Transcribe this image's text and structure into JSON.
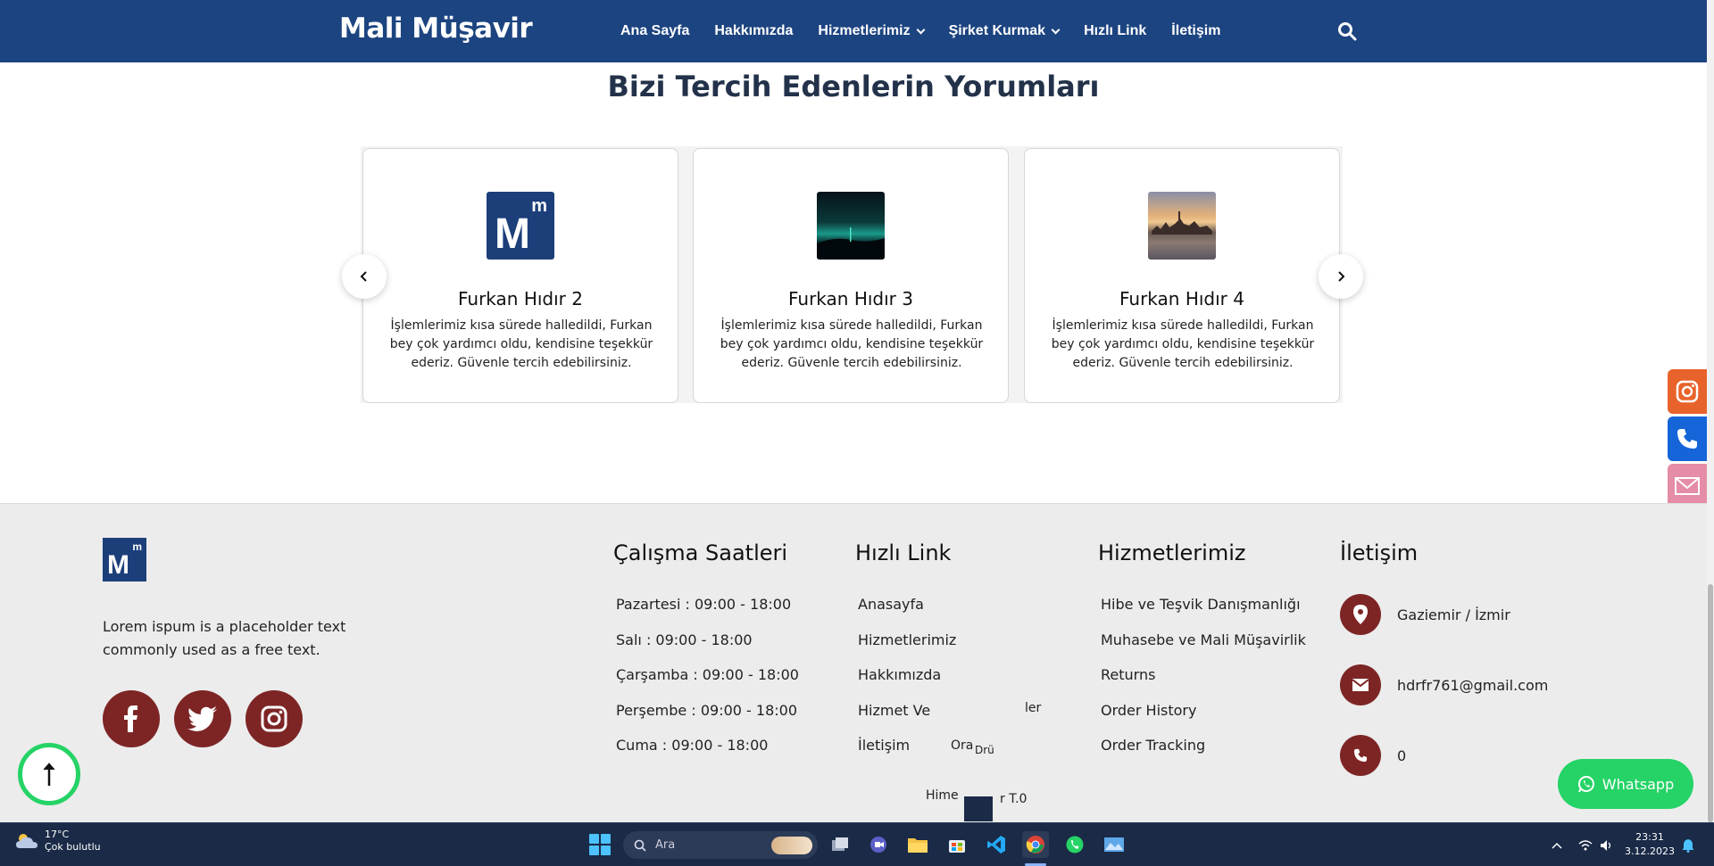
{
  "navbar": {
    "brand": "Mali Müşavir",
    "items": [
      {
        "label": "Ana Sayfa"
      },
      {
        "label": "Hakkımızda"
      },
      {
        "label": "Hizmetlerimiz"
      },
      {
        "label": "Şirket Kurmak"
      },
      {
        "label": "Hızlı Link"
      },
      {
        "label": "İletişim"
      }
    ],
    "search_icon": "search-icon"
  },
  "testimonials": {
    "title": "Bizi Tercih Edenlerin Yorumları",
    "cards": [
      {
        "name": "Furkan Hıdır 2",
        "text": "İşlemlerimiz kısa sürede halledildi, Furkan bey çok yardımcı oldu, kendisine teşekkür ederiz. Güvenle tercih edebilirsiniz.",
        "avatar": "mm-logo"
      },
      {
        "name": "Furkan Hıdır 3",
        "text": "İşlemlerimiz kısa sürede halledildi, Furkan bey çok yardımcı oldu, kendisine teşekkür ederiz. Güvenle tercih edebilirsiniz.",
        "avatar": "aurora-photo"
      },
      {
        "name": "Furkan Hıdır 4",
        "text": "İşlemlerimiz kısa sürede halledildi, Furkan bey çok yardımcı oldu, kendisine teşekkür ederiz. Güvenle tercih edebilirsiniz.",
        "avatar": "city-sunset-photo"
      }
    ],
    "prev_icon": "chevron-left-icon",
    "next_icon": "chevron-right-icon"
  },
  "logo": {
    "big": "M",
    "small": "m"
  },
  "footer": {
    "about": "Lorem ispum is a placeholder text commonly used as a free text.",
    "socials": [
      "facebook-icon",
      "twitter-icon",
      "instagram-icon"
    ],
    "hours": {
      "title": "Çalışma Saatleri",
      "items": [
        "Pazartesi : 09:00 - 18:00",
        "Salı : 09:00 - 18:00",
        "Çarşamba : 09:00 - 18:00",
        "Perşembe : 09:00 - 18:00",
        "Cuma : 09:00 - 18:00"
      ]
    },
    "quick_links": {
      "title": "Hızlı Link",
      "items": [
        "Anasayfa",
        "Hizmetlerimiz",
        "Hakkımızda",
        "Hizmet Ve",
        "İletişim"
      ]
    },
    "services": {
      "title": "Hizmetlerimiz",
      "items": [
        "Hibe ve Teşvik Danışmanlığı",
        "Muhasebe ve Mali Müşavirlik",
        "Returns",
        "Order History",
        "Order Tracking"
      ]
    },
    "contact": {
      "title": "İletişim",
      "address": "Gaziemir / İzmir",
      "email": "hdrfr761@gmail.com",
      "phone": "0"
    },
    "glitch": {
      "a": "ler",
      "b": "Ora",
      "c": "Drü",
      "d": "Hime",
      "e": "r T.0"
    }
  },
  "floating": {
    "whatsapp_label": "Whatsapp",
    "scroll_top_icon": "arrow-up-icon",
    "side": [
      "instagram-icon",
      "phone-icon",
      "mail-icon"
    ],
    "colors": {
      "instagram": "#e8632b",
      "phone": "#1565d8",
      "mail": "#e58ca6"
    }
  },
  "taskbar": {
    "weather_temp": "17°C",
    "weather_desc": "Çok bulutlu",
    "search_placeholder": "Ara",
    "apps": [
      "file-manager-icon",
      "teams-icon",
      "folder-icon",
      "store-icon",
      "vscode-icon",
      "chrome-icon",
      "whatsapp-icon",
      "photos-icon"
    ],
    "time": "23:31",
    "date": "3.12.2023"
  },
  "colors": {
    "nav": "#1c4480",
    "accent": "#7d2525",
    "green": "#25d366",
    "footer_bg": "#ececec"
  }
}
